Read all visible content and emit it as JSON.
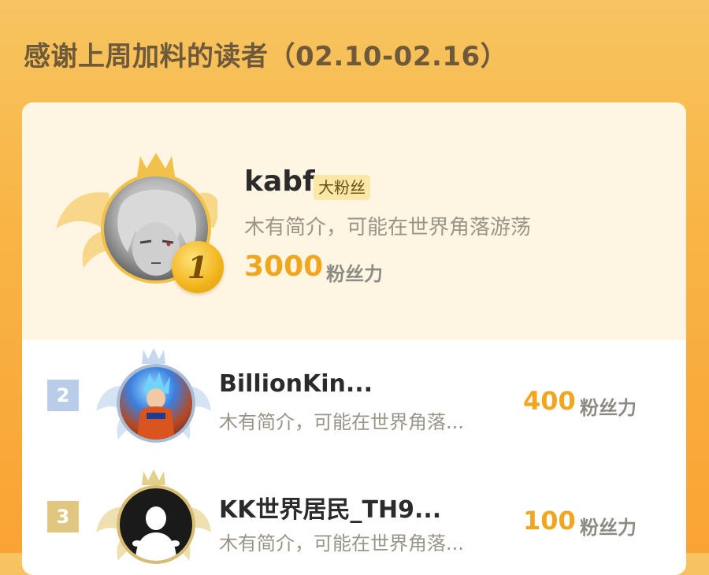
{
  "header": {
    "title": "感谢上周加料的读者（02.10-02.16）"
  },
  "colors": {
    "accent": "#f0a71f",
    "badge_bg": "#fbe7a6",
    "gold": "#f2c14a",
    "silver": "#a9bcd6",
    "bronze": "#d7bd72"
  },
  "top_reader": {
    "rank": "1",
    "name": "kabf",
    "badge": "大粉丝",
    "bio": "木有简介，可能在世界角落游荡",
    "score": "3000",
    "unit": "粉丝力",
    "avatar_icon": "anime-portrait-avatar",
    "frame_icon": "gold-crown-wings-frame-icon"
  },
  "readers": [
    {
      "rank": "2",
      "name": "BillionKin...",
      "bio": "木有简介，可能在世界角落...",
      "score": "400",
      "unit": "粉丝力",
      "avatar_icon": "anime-fighter-avatar",
      "frame_icon": "silver-crown-wings-frame-icon"
    },
    {
      "rank": "3",
      "name": "KK世界居民_TH9...",
      "bio": "木有简介，可能在世界角落...",
      "score": "100",
      "unit": "粉丝力",
      "avatar_icon": "default-person-avatar",
      "frame_icon": "bronze-crown-wings-frame-icon"
    }
  ]
}
